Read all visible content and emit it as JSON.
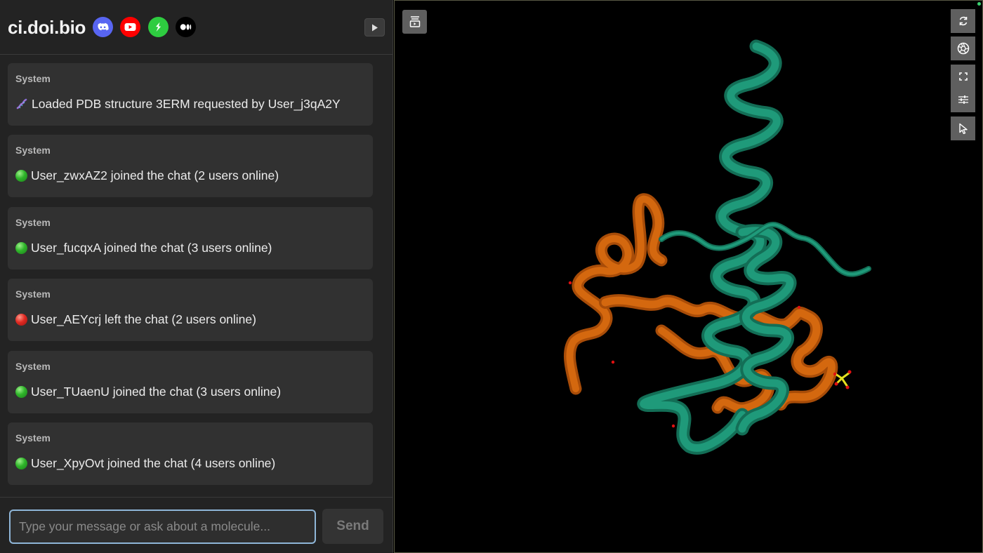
{
  "header": {
    "brand": "ci.doi.bio",
    "social_icons": [
      "discord-icon",
      "youtube-icon",
      "bluesky-icon",
      "medium-icon"
    ],
    "colors": {
      "discord": "#5865F2",
      "youtube": "#FF0000",
      "green_app": "#2ecc40",
      "medium": "#000000"
    }
  },
  "messages": [
    {
      "sender": "System",
      "icon": "dna-icon",
      "text": "Loaded PDB structure 3ERM requested by User_j3qA2Y"
    },
    {
      "sender": "System",
      "icon": "green-circle-icon",
      "text": "User_zwxAZ2 joined the chat (2 users online)"
    },
    {
      "sender": "System",
      "icon": "green-circle-icon",
      "text": "User_fucqxA joined the chat (3 users online)"
    },
    {
      "sender": "System",
      "icon": "red-circle-icon",
      "text": "User_AEYcrj left the chat (2 users online)"
    },
    {
      "sender": "System",
      "icon": "green-circle-icon",
      "text": "User_TUaenU joined the chat (3 users online)"
    },
    {
      "sender": "System",
      "icon": "green-circle-icon",
      "text": "User_XpyOvt joined the chat (4 users online)"
    }
  ],
  "composer": {
    "placeholder": "Type your message or ask about a molecule...",
    "value": "",
    "send_label": "Send"
  },
  "viewer": {
    "structure": "3ERM",
    "toolbar": [
      "reset-view-icon",
      "screenshot-icon",
      "fullscreen-icon",
      "settings-icon",
      "select-cursor-icon"
    ],
    "colors": {
      "chain_a": "#1f9a7a",
      "chain_b": "#d4680f",
      "background": "#000000"
    }
  }
}
